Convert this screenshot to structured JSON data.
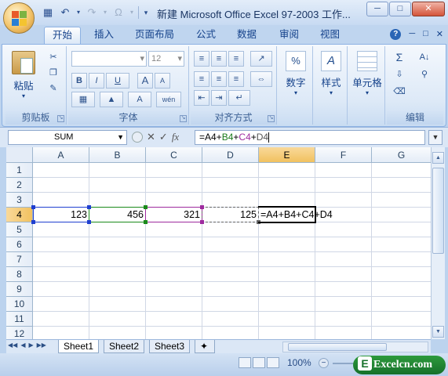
{
  "window": {
    "title": "新建 Microsoft Office Excel 97-2003 工作..."
  },
  "tabs": [
    "开始",
    "插入",
    "页面布局",
    "公式",
    "数据",
    "审阅",
    "视图"
  ],
  "ribbon": {
    "clipboard": {
      "paste_label": "粘贴",
      "group_label": "剪贴板"
    },
    "font": {
      "font_size": "12",
      "group_label": "字体",
      "bold": "B",
      "italic": "I",
      "underline": "U",
      "grow": "A",
      "shrink": "A",
      "font_color": "A",
      "phonetic": "wén"
    },
    "alignment": {
      "group_label": "对齐方式"
    },
    "number": {
      "label": "数字",
      "symbol": "%"
    },
    "styles": {
      "label": "样式"
    },
    "cells": {
      "label": "单元格"
    },
    "editing": {
      "group_label": "编辑",
      "sum": "Σ"
    }
  },
  "formula_bar": {
    "name_box": "SUM",
    "fx_label": "fx",
    "formula_parts": [
      "=A4+",
      "B4",
      "+",
      "C4",
      "+",
      "D4"
    ]
  },
  "columns": [
    "A",
    "B",
    "C",
    "D",
    "E",
    "F",
    "G"
  ],
  "rows": [
    "1",
    "2",
    "3",
    "4",
    "5",
    "6",
    "7",
    "8",
    "9",
    "10",
    "11",
    "12"
  ],
  "cells": {
    "A4": "123",
    "B4": "456",
    "C4": "321",
    "D4": "125",
    "E4": "=A4+B4+C4+D4"
  },
  "sheets": [
    "Sheet1",
    "Sheet2",
    "Sheet3"
  ],
  "status": {
    "zoom": "100%"
  },
  "watermark": {
    "text": "Excelcn.com",
    "letter": "E"
  },
  "colors": {
    "ref_blue": "#1f3fd0",
    "ref_green": "#1a8a1a",
    "ref_purple": "#9e2a9e",
    "active_header": "#f1c15f"
  }
}
